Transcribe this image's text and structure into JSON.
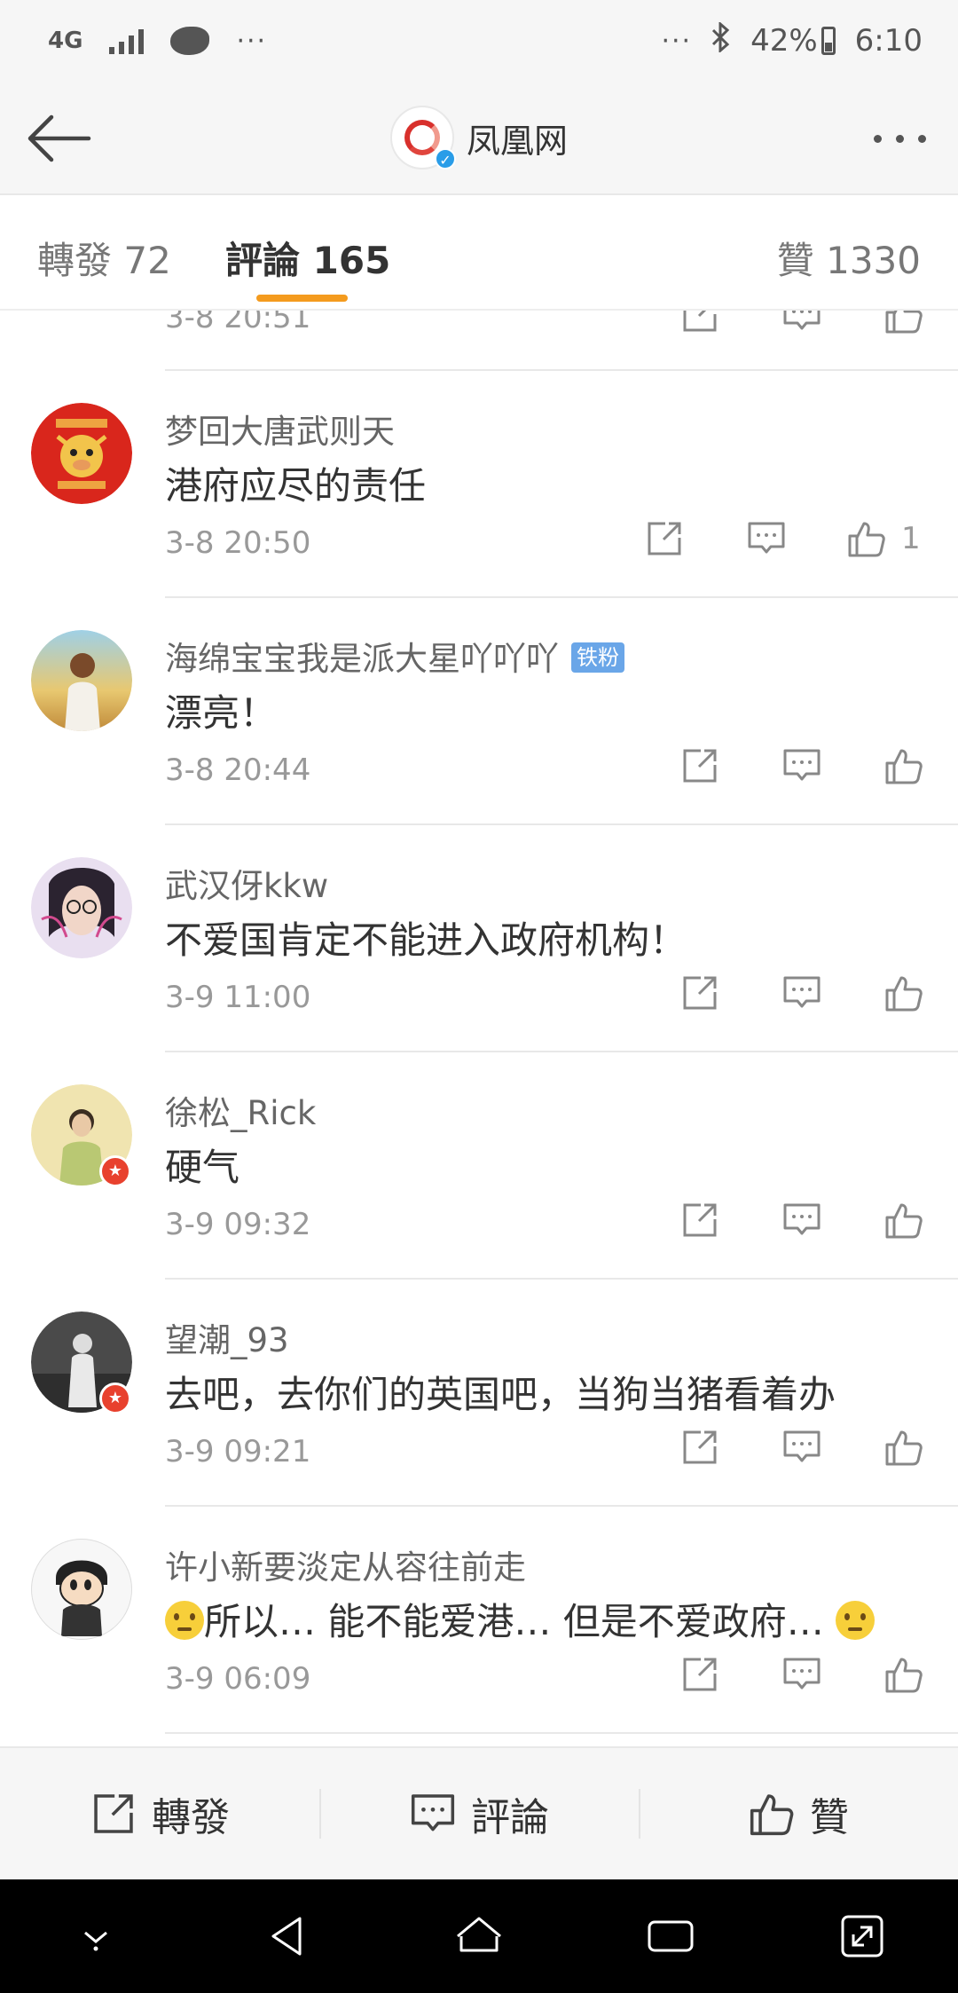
{
  "status_bar": {
    "network": "4G",
    "overflow_left": "···",
    "overflow_right": "···",
    "battery": "42%",
    "time": "6:10"
  },
  "header": {
    "title": "凤凰网",
    "logo_icon": "ifeng-logo-icon"
  },
  "tabs": {
    "repost": "轉發 72",
    "comment": "評論 165",
    "like": "贊 1330",
    "accent_color": "#f49b1e"
  },
  "comments": {
    "partial_time": "3-8 20:51",
    "items": [
      {
        "user": "梦回大唐武则天",
        "text": "港府应尽的责任",
        "time": "3-8 20:50",
        "likes": "1"
      },
      {
        "user": "海绵宝宝我是派大星吖吖吖",
        "tag": "铁粉",
        "text": "漂亮！",
        "time": "3-8 20:44"
      },
      {
        "user": "武汉伢kkw",
        "text": "不爱国肯定不能进入政府机构！",
        "time": "3-9 11:00"
      },
      {
        "user": "徐松_Rick",
        "text": "硬气",
        "time": "3-9 09:32"
      },
      {
        "user": "望潮_93",
        "text": "去吧，去你们的英国吧，当狗当猪看着办",
        "time": "3-9 09:21"
      },
      {
        "user": "许小新要淡定从容往前走",
        "text": "所以… 能不能爱港… 但是不爱政府…",
        "time": "3-9 06:09"
      }
    ]
  },
  "bottom_bar": {
    "repost": "轉發",
    "comment": "評論",
    "like": "贊"
  }
}
